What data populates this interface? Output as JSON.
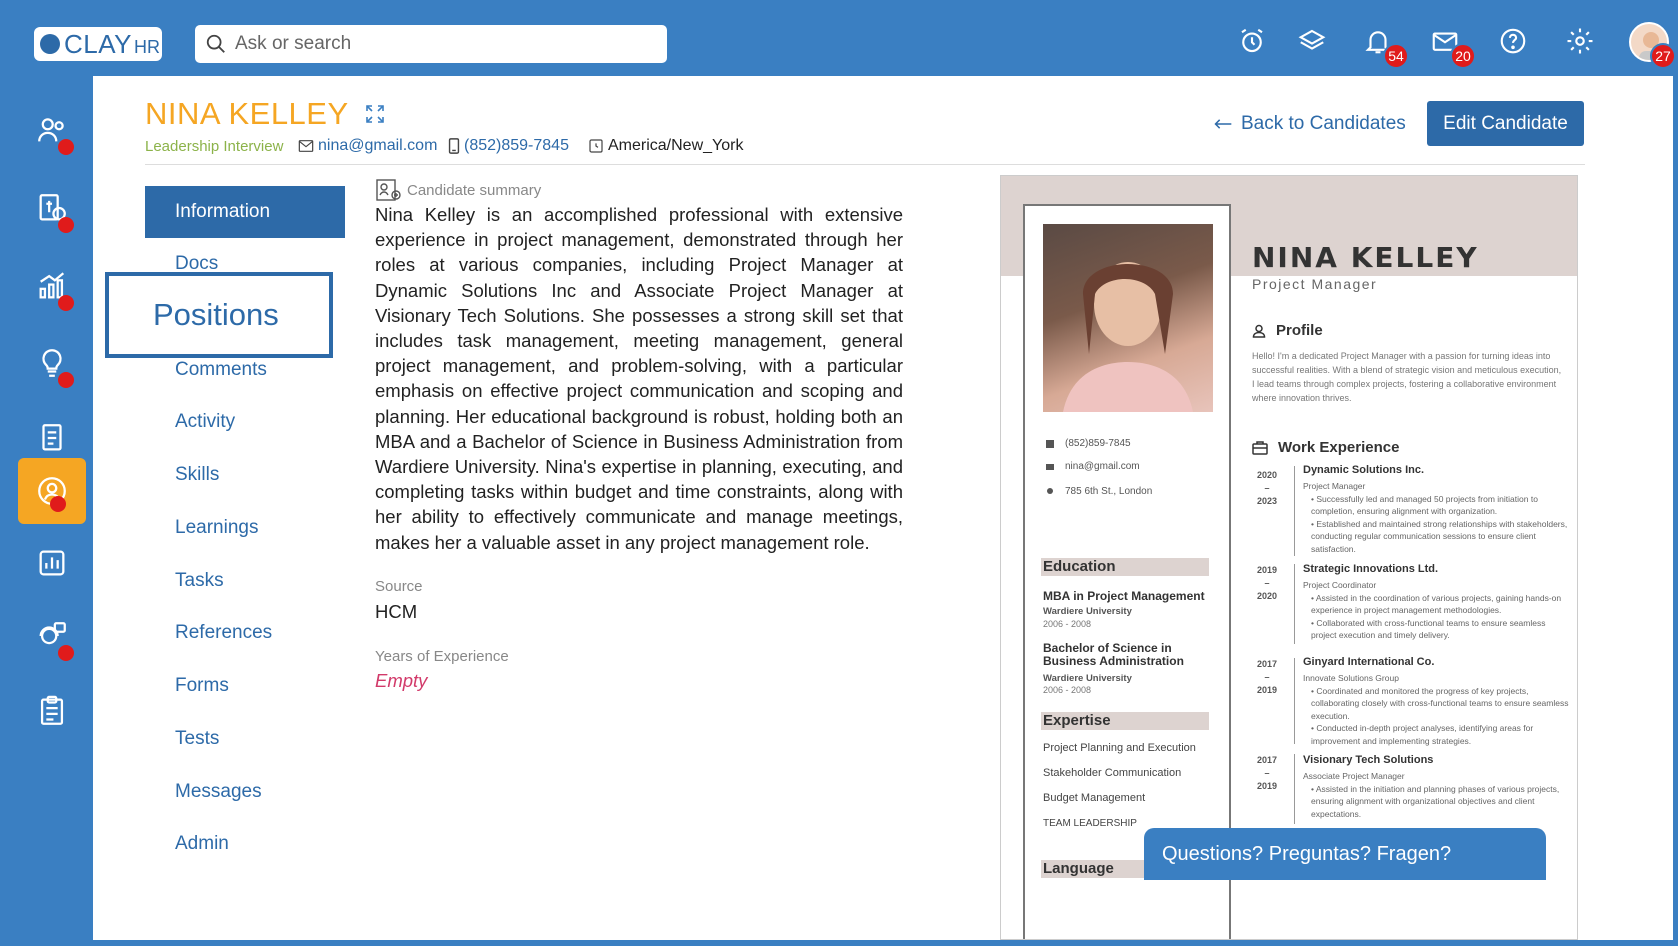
{
  "app": {
    "logo_text": "CLAY",
    "logo_suffix": "HR",
    "search_placeholder": "Ask or search",
    "notifications_count": "54",
    "messages_count": "20",
    "profile_count": "27"
  },
  "candidate": {
    "name": "NINA KELLEY",
    "stage": "Leadership Interview",
    "email": "nina@gmail.com",
    "phone": "(852)859-7845",
    "timezone": "America/New_York"
  },
  "actions": {
    "back_label": "Back to Candidates",
    "edit_label": "Edit Candidate"
  },
  "nav": {
    "items": [
      "Information",
      "Docs",
      "Positions",
      "Comments",
      "Activity",
      "Skills",
      "Learnings",
      "Tasks",
      "References",
      "Forms",
      "Tests",
      "Messages",
      "Admin"
    ]
  },
  "summary": {
    "label": "Candidate summary",
    "text": "Nina Kelley is an accomplished professional with extensive experience in project management, demonstrated through her roles at various companies, including Project Manager at Dynamic Solutions Inc and Associate Project Manager at Visionary Tech Solutions. She possesses a strong skill set that includes task management, meeting management, general project management, and problem-solving, with a particular emphasis on effective project communication and scoping and planning. Her educational background is robust, holding both an MBA and a Bachelor of Science in Business Administration from Wardiere University. Nina's expertise in planning, executing, and completing tasks within budget and time constraints, along with her ability to effectively communicate and manage meetings, makes her a valuable asset in any project management role."
  },
  "fields": {
    "source_label": "Source",
    "source_value": "HCM",
    "experience_label": "Years of Experience",
    "experience_value": "Empty"
  },
  "resume": {
    "name": "NINA KELLEY",
    "title": "Project Manager",
    "profile_heading": "Profile",
    "profile_text": "Hello! I'm a dedicated Project Manager with a passion for turning ideas into successful realities. With a blend of strategic vision and meticulous execution, I lead teams through complex projects, fostering a collaborative environment where innovation thrives.",
    "contact": {
      "phone": "(852)859-7845",
      "email": "nina@gmail.com",
      "address": "785 6th St., London"
    },
    "education_heading": "Education",
    "education": [
      {
        "degree": "MBA in Project Management",
        "school": "Wardiere University",
        "years": "2006 - 2008"
      },
      {
        "degree": "Bachelor of Science in Business Administration",
        "school": "Wardiere University",
        "years": "2006 - 2008"
      }
    ],
    "expertise_heading": "Expertise",
    "expertise": [
      "Project Planning and Execution",
      "Stakeholder Communication",
      "Budget Management",
      "TEAM LEADERSHIP"
    ],
    "language_heading": "Language",
    "work_heading": "Work Experience",
    "jobs": [
      {
        "from": "2020",
        "to": "2023",
        "company": "Dynamic Solutions Inc.",
        "role": "Project Manager",
        "bullets": [
          "Successfully led and managed 50 projects from initiation to completion, ensuring alignment with organization.",
          "Established and maintained strong relationships with stakeholders, conducting regular communication sessions to ensure client satisfaction."
        ]
      },
      {
        "from": "2019",
        "to": "2020",
        "company": "Strategic Innovations Ltd.",
        "role": "Project Coordinator",
        "bullets": [
          "Assisted in the coordination of various projects, gaining hands-on experience in project management methodologies.",
          "Collaborated with cross-functional teams to ensure seamless project execution and timely delivery."
        ]
      },
      {
        "from": "2017",
        "to": "2019",
        "company": "Ginyard International Co.",
        "role": "Innovate Solutions Group",
        "bullets": [
          "Coordinated and monitored the progress of key projects, collaborating closely with cross-functional teams to ensure seamless execution.",
          "Conducted in-depth project analyses, identifying areas for improvement and implementing strategies."
        ]
      },
      {
        "from": "2017",
        "to": "2019",
        "company": "Visionary Tech Solutions",
        "role": "Associate Project Manager",
        "bullets": [
          "Assisted in the initiation and planning phases of various projects, ensuring alignment with organizational objectives and client expectations."
        ]
      }
    ]
  },
  "help": {
    "label": "Questions? Preguntas? Fragen?"
  }
}
